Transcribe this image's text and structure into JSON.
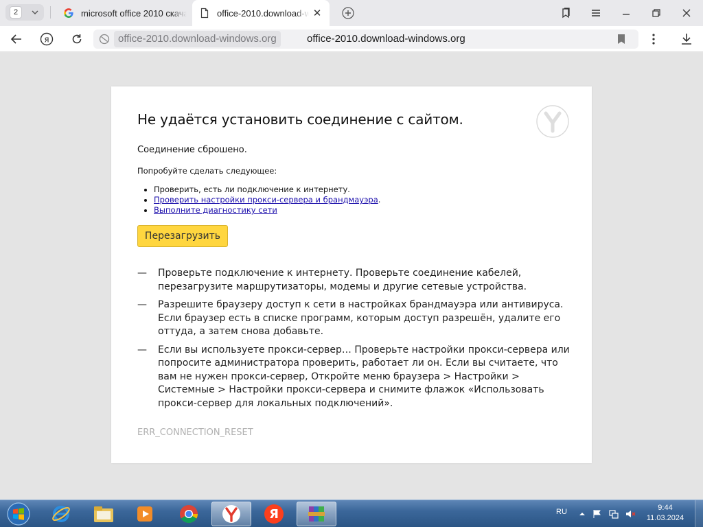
{
  "tabs": {
    "count": "2",
    "items": [
      {
        "title": "microsoft office 2010 скача",
        "favicon": "google-icon"
      },
      {
        "title": "office-2010.download-w",
        "favicon": "page-icon",
        "active": true
      }
    ]
  },
  "address_bar": {
    "domain_chip": "office-2010.download-windows.org",
    "url": "office-2010.download-windows.org"
  },
  "error_page": {
    "title": "Не удаётся установить соединение с сайтом.",
    "subtitle": "Соединение сброшено.",
    "try_label": "Попробуйте сделать следующее:",
    "suggestions": [
      {
        "text": "Проверить, есть ли подключение к интернету.",
        "link": false
      },
      {
        "text": "Проверить настройки прокси-сервера и брандмауэра",
        "link": true,
        "suffix": "."
      },
      {
        "text": "Выполните диагностику сети",
        "link": true,
        "suffix": ""
      }
    ],
    "reload_label": "Перезагрузить",
    "advice": [
      {
        "dash": "—",
        "text": "Проверьте подключение к интернету. Проверьте соединение кабелей, перезагрузите маршрутизаторы, модемы и другие сетевые устройства."
      },
      {
        "dash": "—",
        "text": "Разрешите браузеру доступ к сети в настройках брандмауэра или антивируса. Если браузер есть в списке программ, которым доступ разрешён, удалите его оттуда, а затем снова добавьте."
      },
      {
        "dash": "—",
        "text": "Если вы используете прокси-сервер… Проверьте настройки прокси-сервера или попросите администратора проверить, работает ли он. Если вы считаете, что вам не нужен прокси-сервер, Откройте меню браузера > Настройки > Системные > Настройки прокси-сервера и снимите флажок «Использовать прокси-сервер для локальных подключений»."
      }
    ],
    "error_code": "ERR_CONNECTION_RESET"
  },
  "taskbar": {
    "apps": [
      "internet-explorer-icon",
      "file-explorer-icon",
      "media-player-icon",
      "chrome-icon",
      "yandex-browser-icon",
      "yandex-icon",
      "winrar-icon"
    ],
    "tray": {
      "language": "RU",
      "time": "9:44",
      "date": "11.03.2024"
    }
  },
  "colors": {
    "reload_button": "#ffd63f",
    "link": "#1a0dab",
    "error_code": "#b0b0b0",
    "taskbar": "#3b679a"
  }
}
